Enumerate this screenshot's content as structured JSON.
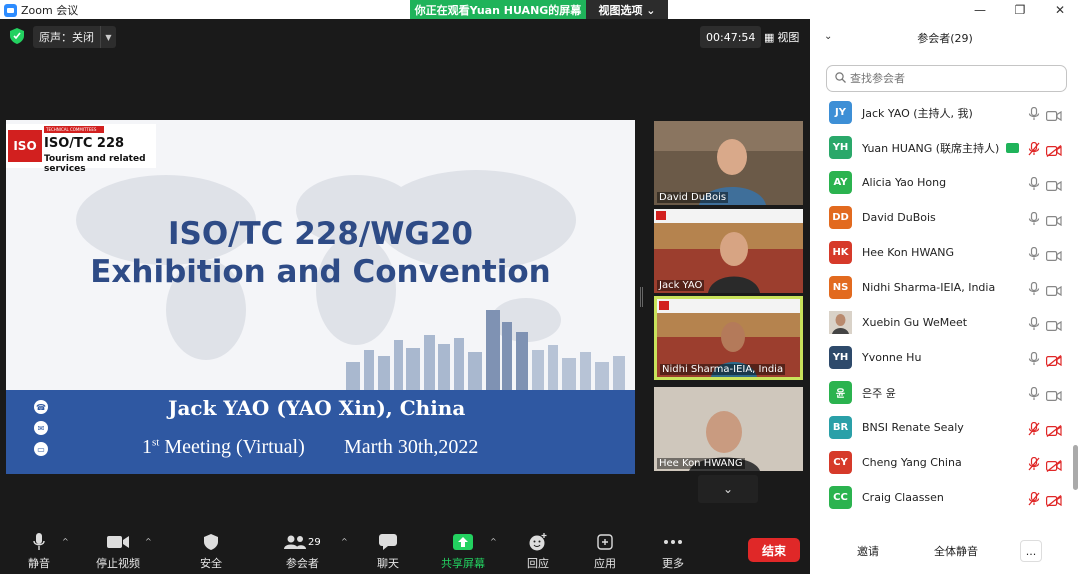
{
  "window": {
    "title": "Zoom 会议",
    "controls": [
      "—",
      "❐",
      "✕"
    ]
  },
  "share_banner": {
    "viewing": "你正在观看Yuan HUANG的屏幕",
    "options": "视图选项 ⌄"
  },
  "top_bar": {
    "original_audio": "原声：关闭",
    "timer": "00:47:54",
    "view": "视图"
  },
  "slide": {
    "iso_logo": "ISO",
    "iso_strip": "TECHNICAL COMMITTEES",
    "iso_tc": "ISO/TC 228",
    "iso_sub": "Tourism and related services",
    "title_line1": "ISO/TC 228/WG20",
    "title_line2": "Exhibition and Convention",
    "presenter": "Jack YAO (YAO Xin), China",
    "meeting_num": "1",
    "meeting_sup": "st",
    "meeting_rest": " Meeting (Virtual)",
    "date": "Marth 30th,2022"
  },
  "tiles": [
    {
      "name": "David DuBois"
    },
    {
      "name": "Jack YAO"
    },
    {
      "name": "Nidhi Sharma-IEIA, India"
    },
    {
      "name": "Hee Kon HWANG"
    }
  ],
  "toolbar": {
    "mute": "静音",
    "stop_video": "停止视频",
    "security": "安全",
    "participants": "参会者",
    "participants_count": "29",
    "chat": "聊天",
    "share": "共享屏幕",
    "reactions": "回应",
    "apps": "应用",
    "more": "更多",
    "end": "结束"
  },
  "panel": {
    "title": "参会者(29)",
    "search_placeholder": "查找参会者",
    "participants": [
      {
        "initials": "JY",
        "name": "Jack YAO (主持人, 我)",
        "color": "#3d8fd6",
        "mic": "on",
        "cam": "on"
      },
      {
        "initials": "YH",
        "name": "Yuan HUANG (联席主持人)",
        "color": "#2aa86a",
        "mic": "off",
        "cam": "off",
        "sharing": true
      },
      {
        "initials": "AY",
        "name": "Alicia Yao Hong",
        "color": "#2bb34f",
        "mic": "on",
        "cam": "on"
      },
      {
        "initials": "DD",
        "name": "David DuBois",
        "color": "#e26a1f",
        "mic": "on",
        "cam": "on"
      },
      {
        "initials": "HK",
        "name": "Hee Kon HWANG",
        "color": "#d63a2a",
        "mic": "on",
        "cam": "on"
      },
      {
        "initials": "NS",
        "name": "Nidhi Sharma-IEIA, India",
        "color": "#e26a1f",
        "mic": "on",
        "cam": "on"
      },
      {
        "initials": "",
        "name": "Xuebin Gu WeMeet",
        "color": "#8a6a5a",
        "mic": "on",
        "cam": "on",
        "photo": true
      },
      {
        "initials": "YH",
        "name": "Yvonne Hu",
        "color": "#2e4a6b",
        "mic": "on",
        "cam": "off"
      },
      {
        "initials": "윤",
        "name": "은주 윤",
        "color": "#2bb34f",
        "mic": "on",
        "cam": "on"
      },
      {
        "initials": "BR",
        "name": "BNSI Renate Sealy",
        "color": "#2aa0a8",
        "mic": "off",
        "cam": "off"
      },
      {
        "initials": "CY",
        "name": "Cheng Yang China",
        "color": "#d63a2a",
        "mic": "off",
        "cam": "off"
      },
      {
        "initials": "CC",
        "name": "Craig Claassen",
        "color": "#2bb34f",
        "mic": "off",
        "cam": "off"
      }
    ],
    "footer": {
      "invite": "邀请",
      "mute_all": "全体静音",
      "more": "..."
    }
  },
  "colors": {
    "accent_green": "#23d160",
    "end_red": "#e02828",
    "slide_blue": "#2f58a2",
    "title_blue": "#2e4b86"
  }
}
